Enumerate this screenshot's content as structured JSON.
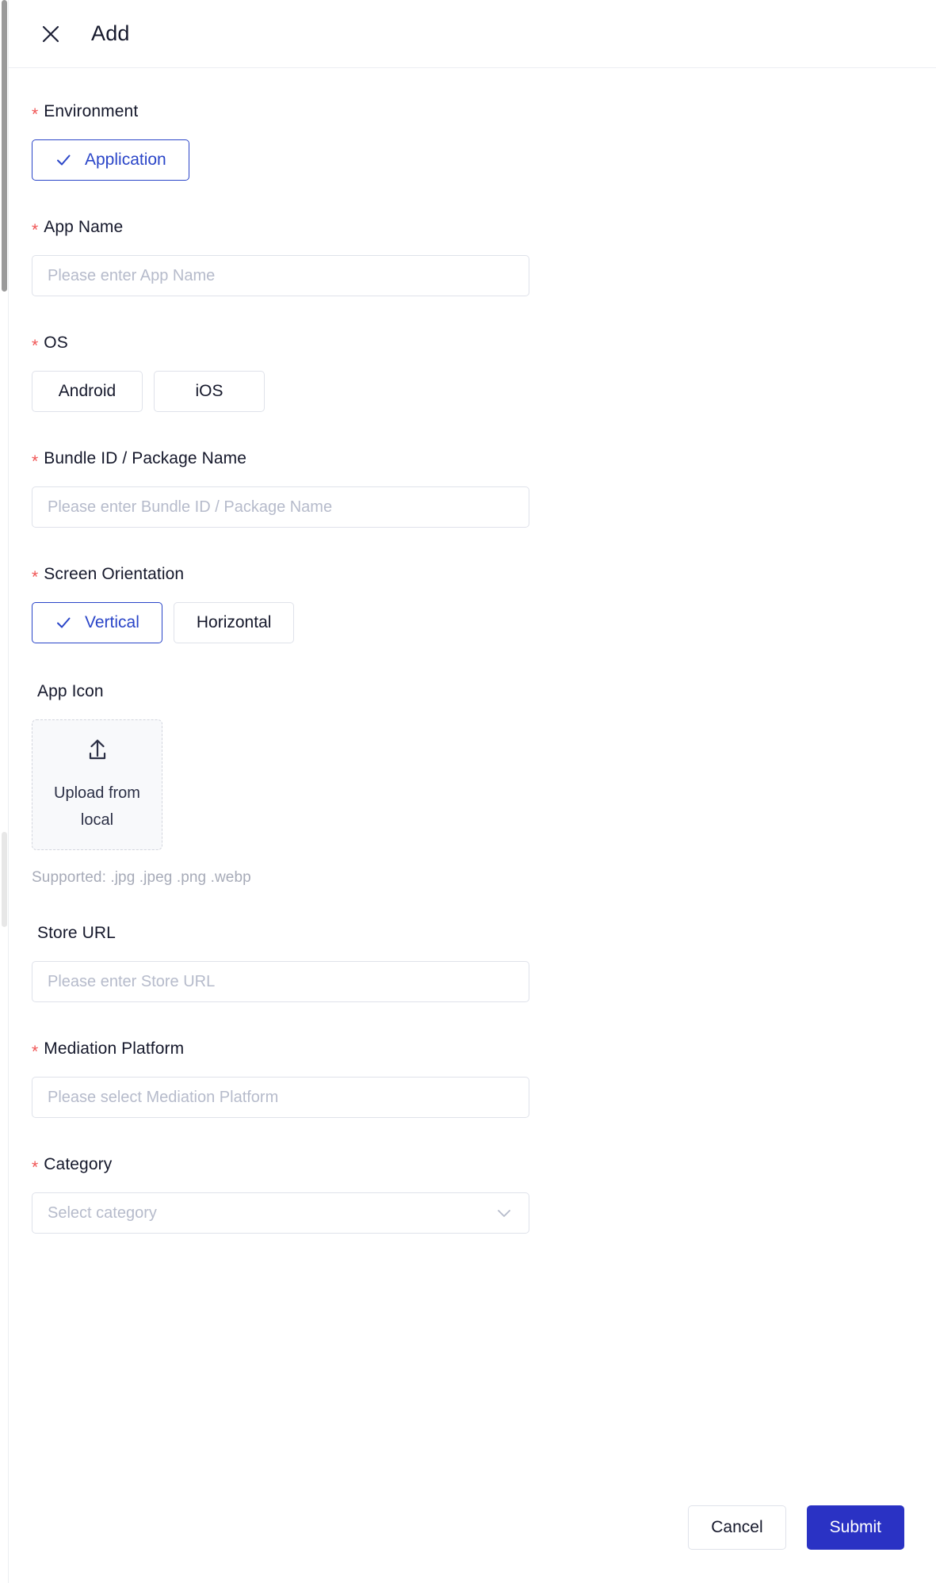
{
  "header": {
    "close_icon": "close-icon",
    "title": "Add"
  },
  "form": {
    "environment": {
      "label": "Environment",
      "required_marker": "*",
      "options": [
        {
          "label": "Application",
          "selected": true
        }
      ]
    },
    "app_name": {
      "label": "App Name",
      "required_marker": "*",
      "value": "",
      "placeholder": "Please enter App Name"
    },
    "os": {
      "label": "OS",
      "required_marker": "*",
      "options": [
        {
          "label": "Android",
          "selected": false
        },
        {
          "label": "iOS",
          "selected": false
        }
      ]
    },
    "bundle_id": {
      "label": "Bundle ID / Package Name",
      "required_marker": "*",
      "value": "",
      "placeholder": "Please enter Bundle ID / Package Name"
    },
    "screen_orientation": {
      "label": "Screen Orientation",
      "required_marker": "*",
      "options": [
        {
          "label": "Vertical",
          "selected": true
        },
        {
          "label": "Horizontal",
          "selected": false
        }
      ]
    },
    "app_icon": {
      "label": "App Icon",
      "required_marker": "",
      "upload_icon": "upload-arrow-icon",
      "upload_text": "Upload from local",
      "hint": "Supported: .jpg .jpeg .png .webp"
    },
    "store_url": {
      "label": "Store URL",
      "required_marker": "",
      "value": "",
      "placeholder": "Please enter Store URL"
    },
    "mediation_platform": {
      "label": "Mediation Platform",
      "required_marker": "*",
      "value": "",
      "placeholder": "Please select Mediation Platform"
    },
    "category": {
      "label": "Category",
      "required_marker": "*",
      "value": "",
      "placeholder": "Select category",
      "chevron_icon": "chevron-down-icon"
    }
  },
  "footer": {
    "cancel_label": "Cancel",
    "submit_label": "Submit"
  },
  "colors": {
    "accent_blue": "#2a45c8",
    "submit_blue": "#2a32c4",
    "required_red": "#f05252",
    "text_primary": "#15182b",
    "placeholder": "#b6bbcb",
    "border": "#dfe2ea"
  }
}
